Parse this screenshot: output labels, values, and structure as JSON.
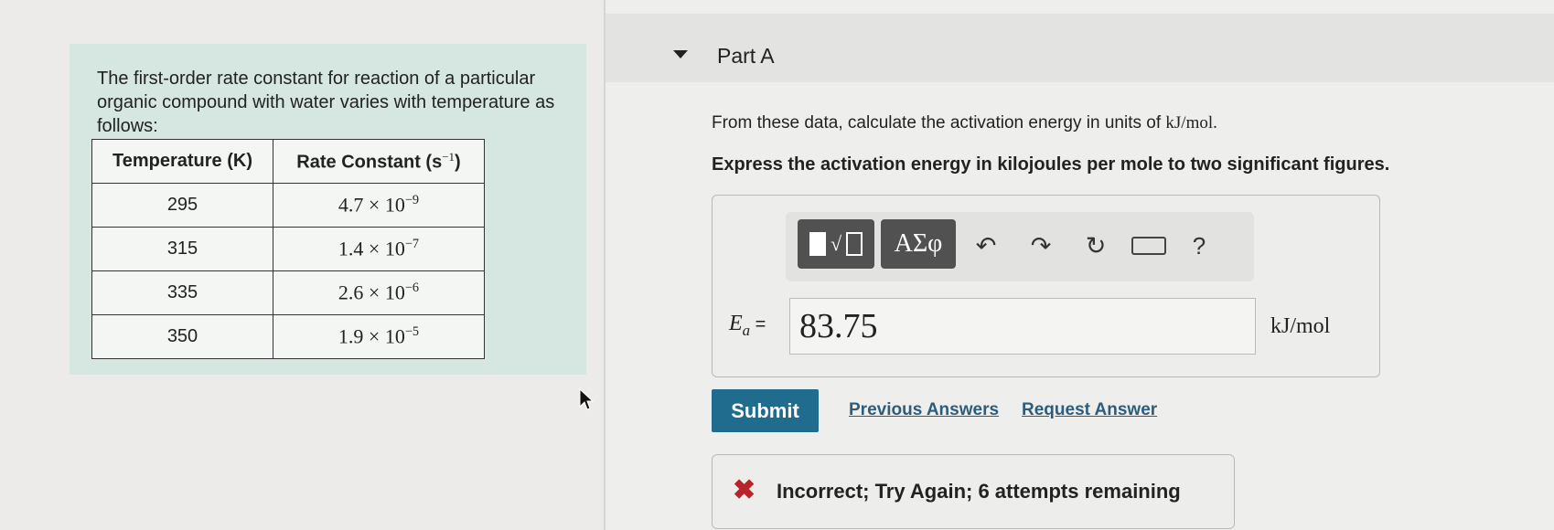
{
  "problem": {
    "text": "The first-order rate constant for reaction of a particular organic compound with water varies with temperature as follows:",
    "table": {
      "headers": {
        "temperature": "Temperature (K)",
        "rate": "Rate Constant (s",
        "rate_exp": "−1",
        "rate_close": ")"
      },
      "rows": [
        {
          "temperature": "295",
          "rate_mantissa": "4.7 × 10",
          "rate_exp": "−9"
        },
        {
          "temperature": "315",
          "rate_mantissa": "1.4 × 10",
          "rate_exp": "−7"
        },
        {
          "temperature": "335",
          "rate_mantissa": "2.6 × 10",
          "rate_exp": "−6"
        },
        {
          "temperature": "350",
          "rate_mantissa": "1.9 × 10",
          "rate_exp": "−5"
        }
      ]
    }
  },
  "part": {
    "title": "Part A",
    "question": "From these data, calculate the activation energy in units of ",
    "question_unit": "kJ/mol.",
    "instruction": "Express the activation energy in kilojoules per mole to two significant figures."
  },
  "toolbar": {
    "greek_label": "ΑΣφ",
    "help_label": "?",
    "icons": [
      "templates-icon",
      "undo-icon",
      "redo-icon",
      "reset-icon",
      "keyboard-icon",
      "help-icon"
    ]
  },
  "answer": {
    "variable": "E",
    "subscript": "a",
    "equals": " =",
    "value": "83.75",
    "unit": "kJ/mol"
  },
  "actions": {
    "submit_label": "Submit",
    "previous_answers_label": "Previous Answers",
    "request_answer_label": "Request Answer"
  },
  "feedback": {
    "text": "Incorrect; Try Again; 6 attempts remaining",
    "icon": "x-icon",
    "color": "#b8242a"
  },
  "colors": {
    "submit_bg": "#1f6c8f",
    "problem_bg": "#d6e6e1",
    "link": "#2e5c7d"
  }
}
